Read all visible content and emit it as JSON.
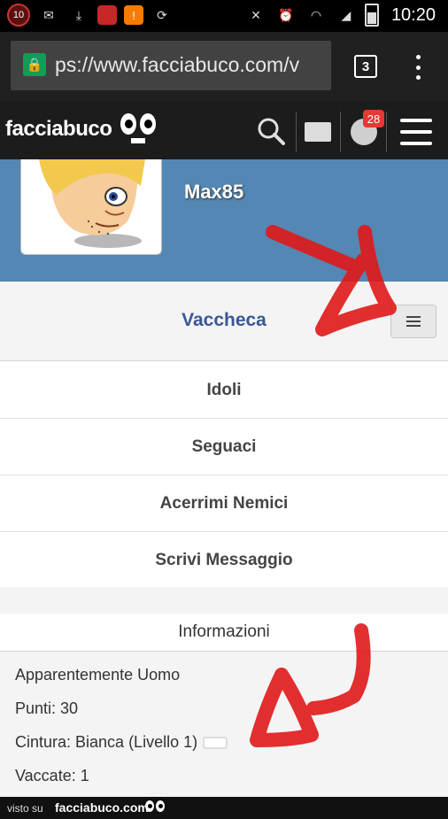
{
  "statusbar": {
    "notification_count": "10",
    "time": "10:20"
  },
  "browser": {
    "url": "ps://www.facciabuco.com/v",
    "tab_count": "3"
  },
  "site": {
    "logo": "facciabuco",
    "notifications_badge": "28"
  },
  "profile": {
    "username": "Max85"
  },
  "rank": {
    "title": "Vaccheca"
  },
  "menu": {
    "items": [
      {
        "label": "Idoli"
      },
      {
        "label": "Seguaci"
      },
      {
        "label": "Acerrimi Nemici"
      },
      {
        "label": "Scrivi Messaggio"
      }
    ]
  },
  "info": {
    "header": "Informazioni",
    "gender": "Apparentemente Uomo",
    "points": "Punti: 30",
    "belt": "Cintura: Bianca (Livello 1)",
    "vaccate": "Vaccate: 1"
  },
  "footer": {
    "visto": "visto su",
    "logo": "facciabuco.com"
  },
  "colors": {
    "banner": "#5487b3",
    "rank_title": "#3a5795",
    "badge": "#e53935",
    "scribble": "#e01818"
  }
}
